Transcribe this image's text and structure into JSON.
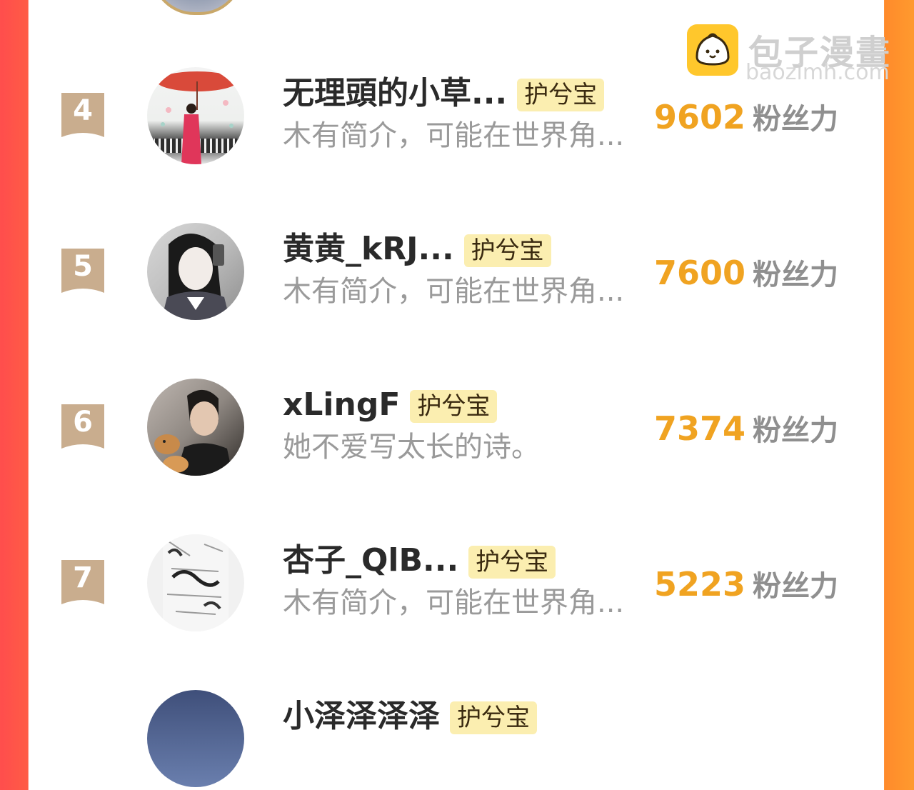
{
  "watermark": {
    "name": "包子漫畫",
    "url": "baozimh.com"
  },
  "score_unit": "粉丝力",
  "rows": [
    {
      "rank": "4",
      "name": "无理頭的小草...",
      "badge": "护兮宝",
      "bio": "木有简介，可能在世界角...",
      "score": "9602"
    },
    {
      "rank": "5",
      "name": "黄黄_kRJ...",
      "badge": "护兮宝",
      "bio": "木有简介，可能在世界角...",
      "score": "7600"
    },
    {
      "rank": "6",
      "name": "xLingF",
      "badge": "护兮宝",
      "bio": "她不爱写太长的诗。",
      "score": "7374"
    },
    {
      "rank": "7",
      "name": "杏子_QlB...",
      "badge": "护兮宝",
      "bio": "木有简介，可能在世界角...",
      "score": "5223"
    },
    {
      "rank": "",
      "name": "小泽泽泽泽",
      "badge": "护兮宝",
      "bio": "",
      "score": ""
    }
  ],
  "colors": {
    "left_bar": "#ff4d4d",
    "right_bar": "#ff9a2e",
    "score": "#f0a321",
    "badge_bg": "#fbeeb0",
    "rank_ribbon": "#c9ad8e"
  }
}
